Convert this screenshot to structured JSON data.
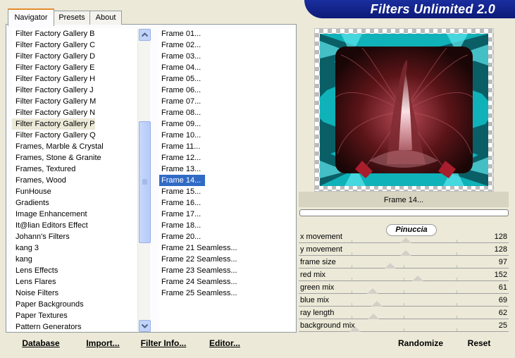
{
  "tabs": [
    {
      "label": "Navigator",
      "active": true
    },
    {
      "label": "Presets",
      "active": false
    },
    {
      "label": "About",
      "active": false
    }
  ],
  "banner": {
    "title": "Filters Unlimited 2.0"
  },
  "categories": [
    {
      "label": "Filter Factory Gallery B"
    },
    {
      "label": "Filter Factory Gallery C"
    },
    {
      "label": "Filter Factory Gallery D"
    },
    {
      "label": "Filter Factory Gallery E"
    },
    {
      "label": "Filter Factory Gallery H"
    },
    {
      "label": "Filter Factory Gallery J"
    },
    {
      "label": "Filter Factory Gallery M"
    },
    {
      "label": "Filter Factory Gallery N"
    },
    {
      "label": "Filter Factory Gallery P",
      "highlighted": true
    },
    {
      "label": "Filter Factory Gallery Q"
    },
    {
      "label": "Frames, Marble & Crystal"
    },
    {
      "label": "Frames, Stone & Granite"
    },
    {
      "label": "Frames, Textured"
    },
    {
      "label": "Frames, Wood"
    },
    {
      "label": "FunHouse"
    },
    {
      "label": "Gradients"
    },
    {
      "label": "Image Enhancement"
    },
    {
      "label": "It@lian Editors Effect"
    },
    {
      "label": "Johann's Filters"
    },
    {
      "label": "kang 3"
    },
    {
      "label": "kang"
    },
    {
      "label": "Lens Effects"
    },
    {
      "label": "Lens Flares"
    },
    {
      "label": "Noise Filters"
    },
    {
      "label": "Paper Backgrounds"
    },
    {
      "label": "Paper Textures"
    },
    {
      "label": "Pattern Generators"
    }
  ],
  "filters": [
    {
      "label": "Frame 01..."
    },
    {
      "label": "Frame 02..."
    },
    {
      "label": "Frame 03..."
    },
    {
      "label": "Frame 04..."
    },
    {
      "label": "Frame 05..."
    },
    {
      "label": "Frame 06..."
    },
    {
      "label": "Frame 07..."
    },
    {
      "label": "Frame 08..."
    },
    {
      "label": "Frame 09..."
    },
    {
      "label": "Frame 10..."
    },
    {
      "label": "Frame 11..."
    },
    {
      "label": "Frame 12..."
    },
    {
      "label": "Frame 13..."
    },
    {
      "label": "Frame 14...",
      "selected": true
    },
    {
      "label": "Frame 15..."
    },
    {
      "label": "Frame 16..."
    },
    {
      "label": "Frame 17..."
    },
    {
      "label": "Frame 18..."
    },
    {
      "label": "Frame 20..."
    },
    {
      "label": "Frame 21 Seamless..."
    },
    {
      "label": "Frame 22 Seamless..."
    },
    {
      "label": "Frame 23 Seamless..."
    },
    {
      "label": "Frame 24 Seamless..."
    },
    {
      "label": "Frame 25 Seamless..."
    }
  ],
  "preview": {
    "filter_name": "Frame 14...",
    "watermark": "Pinuccia",
    "progress": 0
  },
  "params": [
    {
      "label": "x movement",
      "value": 128
    },
    {
      "label": "y movement",
      "value": 128
    },
    {
      "label": "frame size",
      "value": 97
    },
    {
      "label": "red mix",
      "value": 152
    },
    {
      "label": "green mix",
      "value": 61
    },
    {
      "label": "blue mix",
      "value": 69
    },
    {
      "label": "ray length",
      "value": 62
    },
    {
      "label": "background mix",
      "value": 25
    }
  ],
  "buttons": {
    "database": "Database",
    "import": "Import...",
    "filter_info": "Filter Info...",
    "editor": "Editor...",
    "randomize": "Randomize",
    "reset": "Reset"
  },
  "icons": {
    "scroll_up": "chevron-up-icon",
    "scroll_down": "chevron-down-icon",
    "grip": "grip-icon"
  },
  "colors": {
    "selection": "#316ac5",
    "banner": "#1a2e9e",
    "tab_accent": "#e68b2c"
  }
}
